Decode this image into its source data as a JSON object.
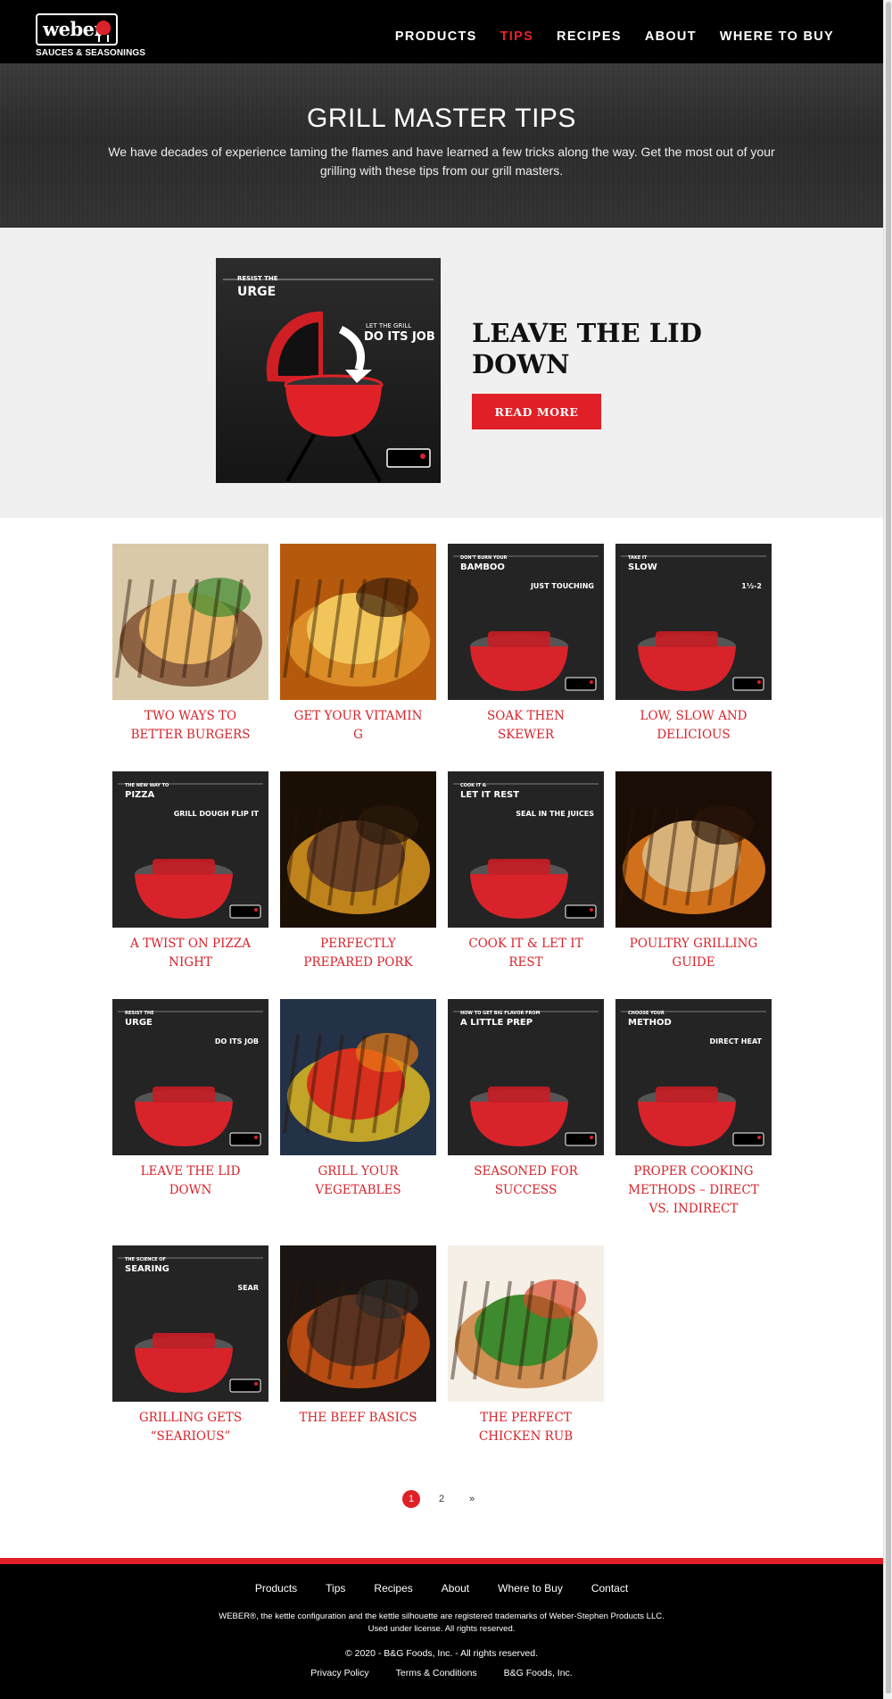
{
  "header": {
    "logo_word": "weber",
    "logo_sub": "SAUCES & SEASONINGS",
    "nav": [
      {
        "label": "PRODUCTS",
        "active": false
      },
      {
        "label": "TIPS",
        "active": true
      },
      {
        "label": "RECIPES",
        "active": false
      },
      {
        "label": "ABOUT",
        "active": false
      },
      {
        "label": "WHERE TO BUY",
        "active": false
      }
    ]
  },
  "hero": {
    "title": "GRILL MASTER TIPS",
    "description": "We have decades of experience taming the flames and have learned a few tricks along the way. Get the most out of your grilling with these tips from our grill masters."
  },
  "featured": {
    "image_top_label": "RESIST THE",
    "image_big_label": "URGE",
    "image_side_label": "LET THE GRILL",
    "image_side_big": "DO ITS JOB",
    "title": "LEAVE THE LID DOWN",
    "button": "READ MORE"
  },
  "tips": [
    {
      "title": "TWO WAYS TO BETTER BURGERS",
      "image": "burger-photo",
      "overlay_small": "",
      "overlay_big": "",
      "overlay_side": ""
    },
    {
      "title": "GET YOUR VITAMIN G",
      "image": "pineapple-photo",
      "overlay_small": "",
      "overlay_big": "",
      "overlay_side": ""
    },
    {
      "title": "SOAK THEN SKEWER",
      "image": "bamboo-graphic",
      "overlay_small": "DON'T BURN YOUR",
      "overlay_big": "BAMBOO",
      "overlay_side": "JUST TOUCHING"
    },
    {
      "title": "LOW, SLOW AND DELICIOUS",
      "image": "ribs-graphic",
      "overlay_small": "TAKE IT",
      "overlay_big": "SLOW",
      "overlay_side": "1½-2"
    },
    {
      "title": "A TWIST ON PIZZA NIGHT",
      "image": "pizza-graphic",
      "overlay_small": "THE NEW WAY TO",
      "overlay_big": "PIZZA",
      "overlay_side": "GRILL DOUGH FLIP IT"
    },
    {
      "title": "PERFECTLY PREPARED PORK",
      "image": "pork-photo",
      "overlay_small": "",
      "overlay_big": "",
      "overlay_side": ""
    },
    {
      "title": "COOK IT & LET IT REST",
      "image": "steak-rest-graphic",
      "overlay_small": "COOK IT &",
      "overlay_big": "LET IT REST",
      "overlay_side": "SEAL IN THE JUICES"
    },
    {
      "title": "POULTRY GRILLING GUIDE",
      "image": "chicken-photo",
      "overlay_small": "",
      "overlay_big": "",
      "overlay_side": ""
    },
    {
      "title": "LEAVE THE LID DOWN",
      "image": "lid-graphic",
      "overlay_small": "RESIST THE",
      "overlay_big": "URGE",
      "overlay_side": "DO ITS JOB"
    },
    {
      "title": "GRILL YOUR VEGETABLES",
      "image": "peppers-photo",
      "overlay_small": "",
      "overlay_big": "",
      "overlay_side": ""
    },
    {
      "title": "SEASONED FOR SUCCESS",
      "image": "prep-graphic",
      "overlay_small": "HOW TO GET BIG FLAVOR FROM",
      "overlay_big": "A LITTLE PREP",
      "overlay_side": ""
    },
    {
      "title": "PROPER COOKING METHODS – DIRECT VS. INDIRECT",
      "image": "method-graphic",
      "overlay_small": "CHOOSE YOUR",
      "overlay_big": "METHOD",
      "overlay_side": "DIRECT HEAT"
    },
    {
      "title": "GRILLING GETS “SEARIOUS”",
      "image": "sear-graphic",
      "overlay_small": "THE SCIENCE OF",
      "overlay_big": "SEARING",
      "overlay_side": "SEAR"
    },
    {
      "title": "THE BEEF BASICS",
      "image": "beef-photo",
      "overlay_small": "",
      "overlay_big": "",
      "overlay_side": ""
    },
    {
      "title": "THE PERFECT CHICKEN RUB",
      "image": "chicken-rub-photo",
      "overlay_small": "",
      "overlay_big": "",
      "overlay_side": ""
    }
  ],
  "pagination": {
    "pages": [
      "1",
      "2"
    ],
    "current": "1",
    "next": "»"
  },
  "footer": {
    "nav": [
      "Products",
      "Tips",
      "Recipes",
      "About",
      "Where to Buy",
      "Contact"
    ],
    "legal_line1": "WEBER®, the kettle configuration and the kettle silhouette are registered trademarks of Weber-Stephen Products LLC.",
    "legal_line2": "Used under license. All rights reserved.",
    "copyright": "© 2020 - B&G Foods, Inc. - All rights reserved.",
    "links": [
      "Privacy Policy",
      "Terms & Conditions",
      "B&G Foods, Inc."
    ]
  },
  "colors": {
    "brand_red": "#e01f26",
    "black": "#000000",
    "featured_bg": "#f0f0f0"
  }
}
